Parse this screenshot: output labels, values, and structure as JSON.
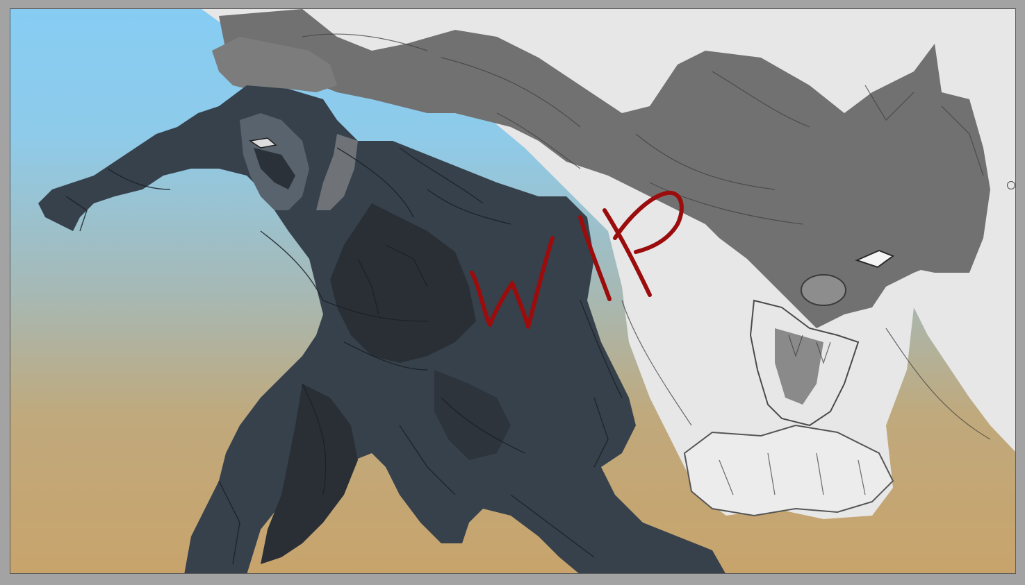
{
  "canvas": {
    "background_top": "#86ccf3",
    "background_mid": "#a6b9b5",
    "background_bottom": "#c8a46c",
    "figure_color": "#36414c",
    "wolf_dark": "#717171",
    "wolf_light": "#e7e7e7",
    "workspace": "#a3a3a3"
  },
  "annotation": {
    "text": "WIP",
    "color": "#9b0c0c"
  },
  "handle": {
    "icon": "resize-handle-icon"
  }
}
